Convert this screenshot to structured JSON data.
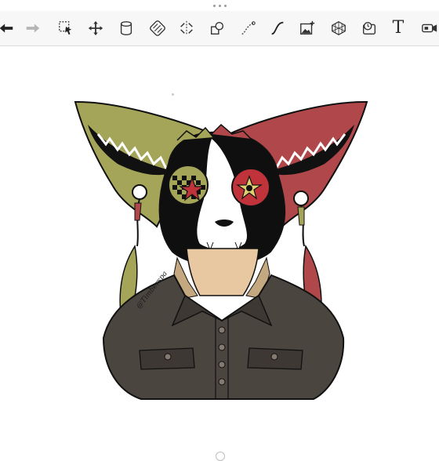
{
  "toolbar": {
    "tools": [
      {
        "id": "undo",
        "icon": "undo-arrow-icon"
      },
      {
        "id": "redo",
        "icon": "redo-arrow-icon"
      },
      {
        "id": "select",
        "icon": "selection-icon"
      },
      {
        "id": "transform",
        "icon": "move-arrows-icon"
      },
      {
        "id": "layer-fill",
        "icon": "cylinder-icon"
      },
      {
        "id": "pattern",
        "icon": "hatch-icon"
      },
      {
        "id": "symmetry",
        "icon": "symmetry-icon"
      },
      {
        "id": "shapes",
        "icon": "shapes-icon"
      },
      {
        "id": "curve",
        "icon": "curve-icon"
      },
      {
        "id": "ruler",
        "icon": "ruler-stroke-icon"
      },
      {
        "id": "image",
        "icon": "image-add-icon"
      },
      {
        "id": "perspective",
        "icon": "perspective-grid-icon"
      },
      {
        "id": "time-lapse",
        "icon": "timelapse-icon"
      },
      {
        "id": "text",
        "icon": "text-icon",
        "glyph": "T"
      },
      {
        "id": "video",
        "icon": "video-icon"
      }
    ]
  },
  "artwork": {
    "watermark": "@Timberspa"
  },
  "colors": {
    "left_ear": "#a4a559",
    "right_ear": "#b0474a",
    "fur_black": "#0f0f0f",
    "skin": "#e8c8a0",
    "shirt": "#4b4540",
    "star_red": "#c0333a"
  }
}
